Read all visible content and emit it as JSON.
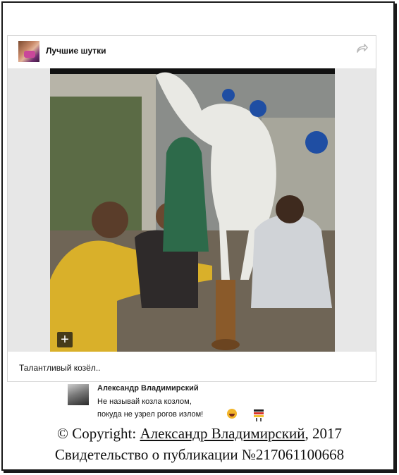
{
  "post": {
    "group_name": "Лучшие шутки",
    "group_avatar_icon": "group-avatar-image",
    "share_icon": "share-arrow-icon",
    "photo_alt": "",
    "expand_label": "+",
    "caption": "Талантливый козёл.."
  },
  "comment": {
    "avatar_icon": "user-avatar-image",
    "author": "Александр Владимирский",
    "line1": "Не называй козла козлом,",
    "line2": "покуда не узрел рогов излом!",
    "emoji": [
      "grinning-face-emoji",
      "flag-emoji"
    ]
  },
  "footer": {
    "line1_prefix": "© Copyright: ",
    "line1_author": "Александр Владимирский",
    "line1_suffix": ", 2017",
    "line2": "Свидетельство о публикации №217061100668"
  },
  "colors": {
    "card_border": "#d6d6d6",
    "media_background": "#e7e7e7",
    "share_icon": "#b8b8b8",
    "outer_frame": "#1a1a1a"
  }
}
